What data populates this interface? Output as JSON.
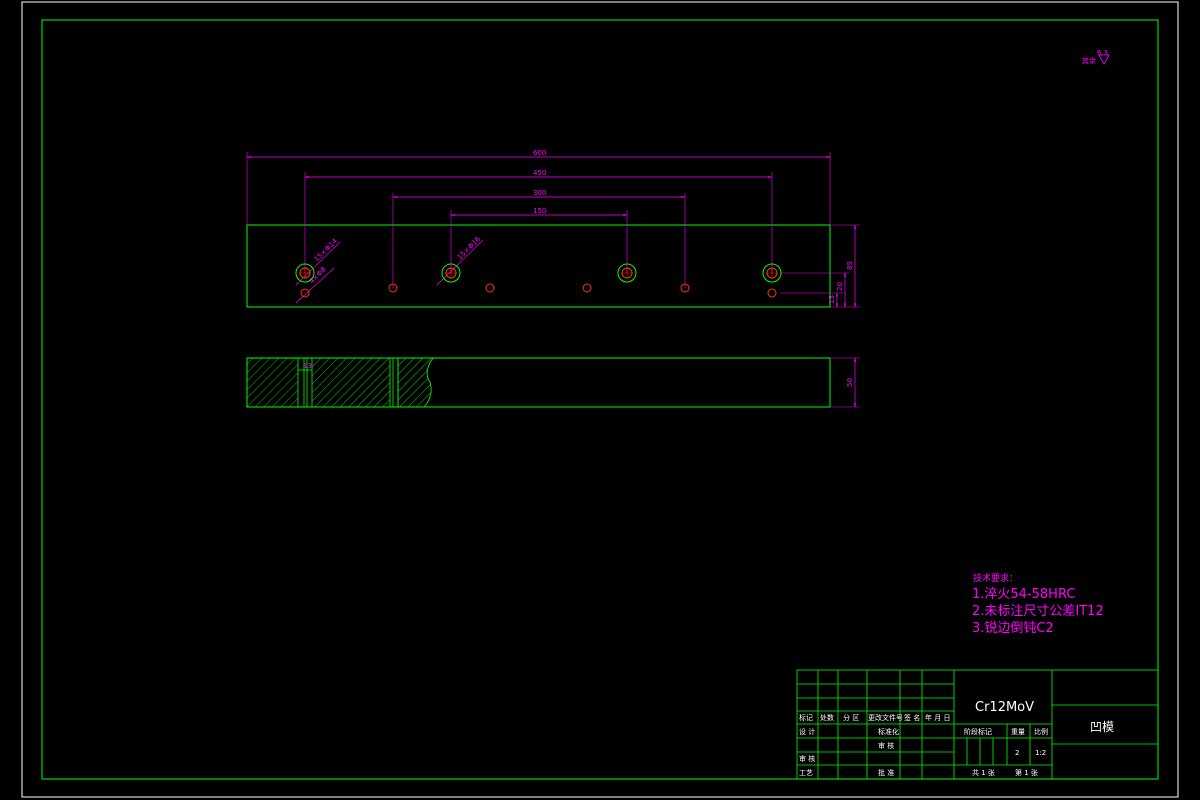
{
  "roughness": {
    "label": "其余",
    "value": "6.3"
  },
  "dimensions": {
    "d600": "600",
    "d450": "450",
    "d300": "300",
    "d150": "150",
    "h_right_85": "85",
    "h_20": "20",
    "h_15": "15",
    "h_side_50": "50",
    "callout_1": "15×Φ14",
    "callout_2": "4×Φ8",
    "callout_3": "15×Φ16",
    "side_small": "13"
  },
  "notes": {
    "title": "技术要求：",
    "items": [
      "1.淬火54-58HRC",
      "2.未标注尺寸公差IT12",
      "3.锐边倒钝C2"
    ]
  },
  "title_block": {
    "material": "Cr12MoV",
    "part_name": "凹模",
    "header_labels": [
      "标记",
      "处数",
      "分 区",
      "更改文件号",
      "签 名",
      "年 月 日"
    ],
    "row_design": "设 计",
    "row_standard": "标准化",
    "row_review": "审 核",
    "row_process": "工艺",
    "row_approve": "批 准",
    "row_check": "审 核",
    "stage_label": "阶段标记",
    "weight_label": "重量",
    "scale_label": "比例",
    "weight_value": "2",
    "scale_value": "1:2",
    "total_sheets": "共 1 张",
    "sheet_no": "第 1 张"
  },
  "colors": {
    "border": "#ffffff",
    "frame": "#00ff00",
    "dimension": "#ff00ff",
    "hole": "#ff3300",
    "hatch": "#00ff00"
  }
}
